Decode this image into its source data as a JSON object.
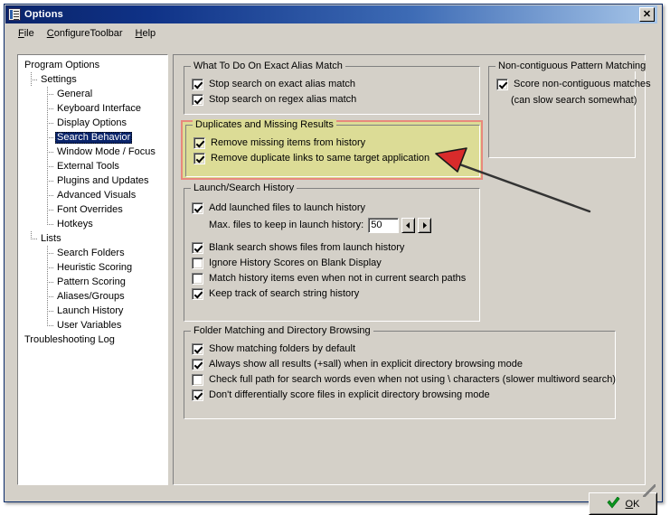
{
  "window": {
    "title": "Options",
    "icon": "options-checklist-icon",
    "close_label": "✕"
  },
  "menubar": {
    "items": [
      {
        "label": "File",
        "accel": "F"
      },
      {
        "label": "ConfigureToolbar",
        "accel": "C"
      },
      {
        "label": "Help",
        "accel": "H"
      }
    ]
  },
  "tree": {
    "nodes": [
      {
        "label": "Program Options",
        "level": 0,
        "selected": false,
        "last": false
      },
      {
        "label": "Settings",
        "level": 1,
        "selected": false,
        "last": false
      },
      {
        "label": "General",
        "level": 2,
        "selected": false,
        "last": false
      },
      {
        "label": "Keyboard Interface",
        "level": 2,
        "selected": false,
        "last": false
      },
      {
        "label": "Display Options",
        "level": 2,
        "selected": false,
        "last": false
      },
      {
        "label": "Search Behavior",
        "level": 2,
        "selected": true,
        "last": false
      },
      {
        "label": "Window Mode / Focus",
        "level": 2,
        "selected": false,
        "last": false
      },
      {
        "label": "External Tools",
        "level": 2,
        "selected": false,
        "last": false
      },
      {
        "label": "Plugins and Updates",
        "level": 2,
        "selected": false,
        "last": false
      },
      {
        "label": "Advanced Visuals",
        "level": 2,
        "selected": false,
        "last": false
      },
      {
        "label": "Font Overrides",
        "level": 2,
        "selected": false,
        "last": false
      },
      {
        "label": "Hotkeys",
        "level": 2,
        "selected": false,
        "last": true
      },
      {
        "label": "Lists",
        "level": 1,
        "selected": false,
        "last": true
      },
      {
        "label": "Search Folders",
        "level": 2,
        "selected": false,
        "last": false
      },
      {
        "label": "Heuristic Scoring",
        "level": 2,
        "selected": false,
        "last": false
      },
      {
        "label": "Pattern Scoring",
        "level": 2,
        "selected": false,
        "last": false
      },
      {
        "label": "Aliases/Groups",
        "level": 2,
        "selected": false,
        "last": false
      },
      {
        "label": "Launch History",
        "level": 2,
        "selected": false,
        "last": false
      },
      {
        "label": "User Variables",
        "level": 2,
        "selected": false,
        "last": true
      },
      {
        "label": "Troubleshooting Log",
        "level": 0,
        "selected": false,
        "last": false
      }
    ]
  },
  "groups": {
    "exact_alias": {
      "title": "What To Do On Exact Alias Match",
      "options": [
        {
          "label": "Stop search on exact alias match",
          "checked": true
        },
        {
          "label": "Stop search on regex alias match",
          "checked": true
        }
      ]
    },
    "non_contiguous": {
      "title": "Non-contiguous Pattern Matching",
      "options": [
        {
          "label": "Score non-contiguous matches",
          "checked": true
        }
      ],
      "note": "(can slow search somewhat)"
    },
    "duplicates": {
      "title": "Duplicates and Missing Results",
      "highlighted": true,
      "highlight_fill": "#dcdc96",
      "highlight_border": "#e8897c",
      "options": [
        {
          "label": "Remove missing items from history",
          "checked": true
        },
        {
          "label": "Remove duplicate links to same target application",
          "checked": true
        }
      ]
    },
    "launch_history": {
      "title": "Launch/Search History",
      "options_top": [
        {
          "label": "Add launched files to launch history",
          "checked": true
        }
      ],
      "spinner": {
        "label": "Max. files to keep in launch history:",
        "value": "50",
        "dec_icon": "arrow-left-icon",
        "inc_icon": "arrow-right-icon"
      },
      "options_bottom": [
        {
          "label": "Blank search shows files from launch history",
          "checked": true
        },
        {
          "label": "Ignore History Scores on Blank Display",
          "checked": false
        },
        {
          "label": "Match history items even when not in current search paths",
          "checked": false
        },
        {
          "label": "Keep track of search string history",
          "checked": true
        }
      ]
    },
    "folder_matching": {
      "title": "Folder Matching and Directory Browsing",
      "options": [
        {
          "label": "Show matching folders by default",
          "checked": true
        },
        {
          "label": "Always show all results (+sall) when in explicit directory browsing mode",
          "checked": true
        },
        {
          "label": "Check full path for search words even when not using \\ characters (slower multiword search)",
          "checked": false
        },
        {
          "label": "Don't differentially score files in explicit directory browsing mode",
          "checked": true
        }
      ]
    }
  },
  "buttons": {
    "ok": {
      "label": "OK",
      "accel": "O",
      "icon": "green-check-icon"
    }
  },
  "annotation": {
    "arrow_color": "#d92b2b",
    "line_color": "#333333"
  }
}
